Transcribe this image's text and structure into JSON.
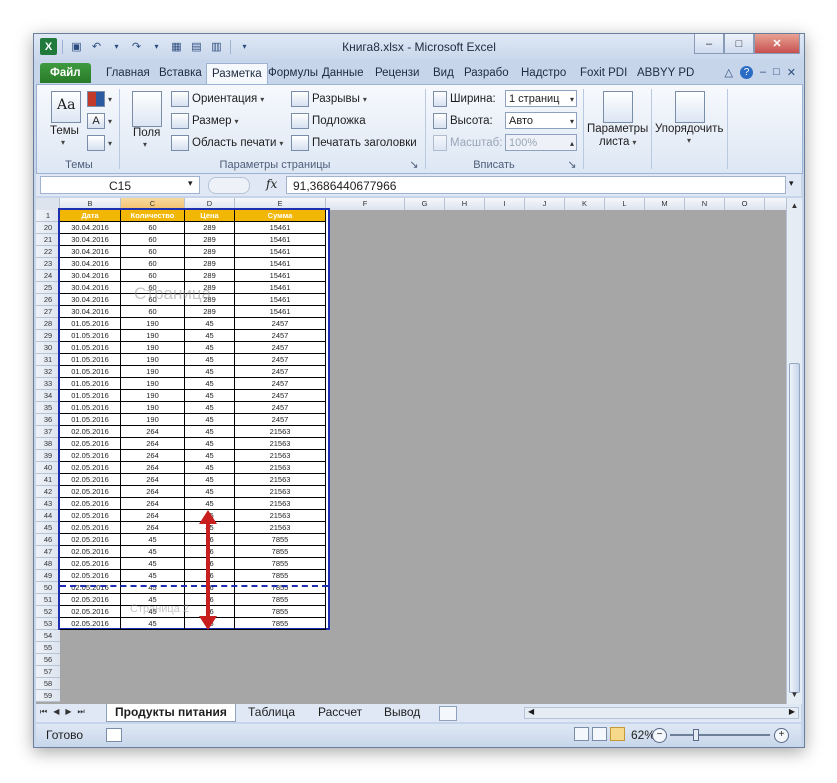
{
  "window": {
    "title": "Книга8.xlsx - Microsoft Excel"
  },
  "tabs": {
    "file": "Файл",
    "items": [
      "Главная",
      "Вставка",
      "Разметка",
      "Формулы",
      "Данные",
      "Рецензи",
      "Вид",
      "Разрабо",
      "Надстро",
      "Foxit PDI",
      "ABBYY PD"
    ],
    "active_index": 2
  },
  "ribbon": {
    "themes": {
      "label": "Темы",
      "group": "Темы"
    },
    "page_setup": {
      "fields": "Поля",
      "orientation": "Ориентация",
      "size": "Размер",
      "print_area": "Область печати",
      "breaks": "Разрывы",
      "background": "Подложка",
      "print_titles": "Печатать заголовки",
      "group": "Параметры страницы"
    },
    "fit": {
      "width_label": "Ширина:",
      "width_value": "1 страниц",
      "height_label": "Высота:",
      "height_value": "Авто",
      "scale_label": "Масштаб:",
      "scale_value": "100%",
      "group": "Вписать"
    },
    "sheet_options": {
      "label_line1": "Параметры",
      "label_line2": "листа"
    },
    "arrange": {
      "label": "Упорядочить"
    }
  },
  "formula_bar": {
    "name_box": "C15",
    "fx": "fx",
    "formula": "91,3686440677966"
  },
  "columns": {
    "letters": [
      "B",
      "C",
      "D",
      "E",
      "F",
      "G",
      "H",
      "I",
      "J",
      "K",
      "L",
      "M",
      "N",
      "O"
    ],
    "selected": "C"
  },
  "table": {
    "header_row": "1",
    "headers": [
      "Дата",
      "Количество",
      "Цена",
      "Сумма"
    ],
    "rows": [
      {
        "n": "20",
        "date": "30.04.2016",
        "qty": "60",
        "price": "289",
        "sum": "15461"
      },
      {
        "n": "21",
        "date": "30.04.2016",
        "qty": "60",
        "price": "289",
        "sum": "15461"
      },
      {
        "n": "22",
        "date": "30.04.2016",
        "qty": "60",
        "price": "289",
        "sum": "15461"
      },
      {
        "n": "23",
        "date": "30.04.2016",
        "qty": "60",
        "price": "289",
        "sum": "15461"
      },
      {
        "n": "24",
        "date": "30.04.2016",
        "qty": "60",
        "price": "289",
        "sum": "15461"
      },
      {
        "n": "25",
        "date": "30.04.2016",
        "qty": "60",
        "price": "289",
        "sum": "15461"
      },
      {
        "n": "26",
        "date": "30.04.2016",
        "qty": "60",
        "price": "289",
        "sum": "15461"
      },
      {
        "n": "27",
        "date": "30.04.2016",
        "qty": "60",
        "price": "289",
        "sum": "15461"
      },
      {
        "n": "28",
        "date": "01.05.2016",
        "qty": "190",
        "price": "45",
        "sum": "2457"
      },
      {
        "n": "29",
        "date": "01.05.2016",
        "qty": "190",
        "price": "45",
        "sum": "2457"
      },
      {
        "n": "30",
        "date": "01.05.2016",
        "qty": "190",
        "price": "45",
        "sum": "2457"
      },
      {
        "n": "31",
        "date": "01.05.2016",
        "qty": "190",
        "price": "45",
        "sum": "2457"
      },
      {
        "n": "32",
        "date": "01.05.2016",
        "qty": "190",
        "price": "45",
        "sum": "2457"
      },
      {
        "n": "33",
        "date": "01.05.2016",
        "qty": "190",
        "price": "45",
        "sum": "2457"
      },
      {
        "n": "34",
        "date": "01.05.2016",
        "qty": "190",
        "price": "45",
        "sum": "2457"
      },
      {
        "n": "35",
        "date": "01.05.2016",
        "qty": "190",
        "price": "45",
        "sum": "2457"
      },
      {
        "n": "36",
        "date": "01.05.2016",
        "qty": "190",
        "price": "45",
        "sum": "2457"
      },
      {
        "n": "37",
        "date": "02.05.2016",
        "qty": "264",
        "price": "45",
        "sum": "21563"
      },
      {
        "n": "38",
        "date": "02.05.2016",
        "qty": "264",
        "price": "45",
        "sum": "21563"
      },
      {
        "n": "39",
        "date": "02.05.2016",
        "qty": "264",
        "price": "45",
        "sum": "21563"
      },
      {
        "n": "40",
        "date": "02.05.2016",
        "qty": "264",
        "price": "45",
        "sum": "21563"
      },
      {
        "n": "41",
        "date": "02.05.2016",
        "qty": "264",
        "price": "45",
        "sum": "21563"
      },
      {
        "n": "42",
        "date": "02.05.2016",
        "qty": "264",
        "price": "45",
        "sum": "21563"
      },
      {
        "n": "43",
        "date": "02.05.2016",
        "qty": "264",
        "price": "45",
        "sum": "21563"
      },
      {
        "n": "44",
        "date": "02.05.2016",
        "qty": "264",
        "price": "45",
        "sum": "21563"
      },
      {
        "n": "45",
        "date": "02.05.2016",
        "qty": "264",
        "price": "45",
        "sum": "21563"
      },
      {
        "n": "46",
        "date": "02.05.2016",
        "qty": "45",
        "price": "36",
        "sum": "7855"
      },
      {
        "n": "47",
        "date": "02.05.2016",
        "qty": "45",
        "price": "36",
        "sum": "7855"
      },
      {
        "n": "48",
        "date": "02.05.2016",
        "qty": "45",
        "price": "36",
        "sum": "7855"
      },
      {
        "n": "49",
        "date": "02.05.2016",
        "qty": "45",
        "price": "36",
        "sum": "7855"
      },
      {
        "n": "50",
        "date": "02.05.2016",
        "qty": "45",
        "price": "36",
        "sum": "7855"
      },
      {
        "n": "51",
        "date": "02.05.2016",
        "qty": "45",
        "price": "36",
        "sum": "7855"
      },
      {
        "n": "52",
        "date": "02.05.2016",
        "qty": "45",
        "price": "36",
        "sum": "7855"
      },
      {
        "n": "53",
        "date": "02.05.2016",
        "qty": "45",
        "price": "36",
        "sum": "7855"
      }
    ],
    "empty_rows": [
      "54",
      "55",
      "56",
      "57",
      "58",
      "59"
    ]
  },
  "watermarks": {
    "page1": "Страница",
    "page2": "Страница 2"
  },
  "sheet_tabs": {
    "items": [
      "Продукты питания",
      "Таблица",
      "Рассчет",
      "Вывод"
    ],
    "active_index": 0
  },
  "status": {
    "ready": "Готово",
    "zoom": "62%"
  },
  "colors": {
    "header_fill": "#f2b705",
    "page_border": "#1d2fb0",
    "arrow": "#c81e1e"
  },
  "icons": [
    "excel-icon",
    "save-icon",
    "undo-icon",
    "redo-icon",
    "help-icon",
    "minimize-icon",
    "restore-icon",
    "close-icon"
  ]
}
